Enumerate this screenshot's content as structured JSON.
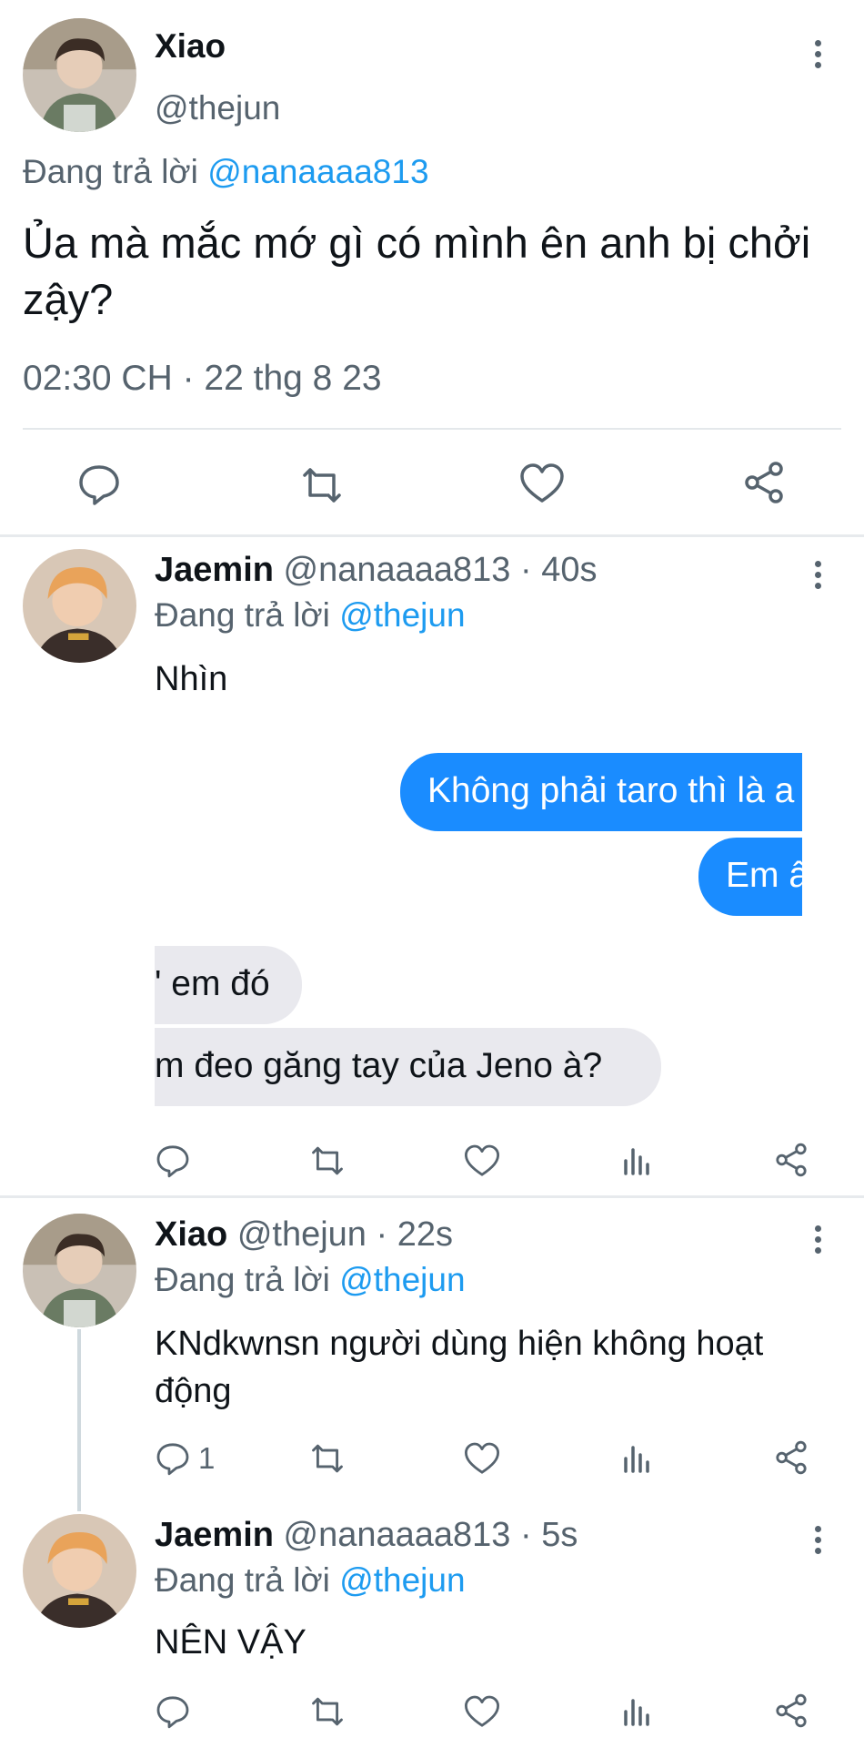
{
  "main_tweet": {
    "name": "Xiao",
    "handle": "@thejun",
    "replying_prefix": "Đang trả lời",
    "replying_to": "@nanaaaa813",
    "text": "Ủa mà mắc mớ gì có mình ên anh bị chởi zậy?",
    "timestamp": "02:30 CH · 22 thg 8 23",
    "actions": [
      "reply-icon",
      "retweet-icon",
      "like-icon",
      "share-icon"
    ]
  },
  "replies": [
    {
      "name": "Jaemin",
      "meta": "@nanaaaa813 · 40s",
      "replying_prefix": "Đang trả lời",
      "replying_to": "@thejun",
      "text": "Nhìn",
      "image_messages": [
        {
          "side": "right",
          "color": "#1a8cff",
          "text": "Không phải taro thì là a"
        },
        {
          "side": "right",
          "color": "#1a8cff",
          "text": "Em ấ"
        },
        {
          "side": "left",
          "color": "#e9e9ee",
          "text": "' em đó"
        },
        {
          "side": "left",
          "color": "#e9e9ee",
          "text": "m đeo găng tay của Jeno à?"
        }
      ]
    },
    {
      "name": "Xiao",
      "meta": "@thejun · 22s",
      "replying_prefix": "Đang trả lời",
      "replying_to": "@thejun",
      "text": "KNdkwnsn người dùng hiện không hoạt động",
      "reply_count": "1"
    },
    {
      "name": "Jaemin",
      "meta": "@nanaaaa813 · 5s",
      "replying_prefix": "Đang trả lời",
      "replying_to": "@thejun",
      "text": "NÊN VẬY"
    }
  ],
  "colors": {
    "link": "#1d9bf0",
    "secondary_text": "#56636e",
    "chat_blue": "#1a8cff",
    "chat_grey": "#e9e9ee"
  }
}
